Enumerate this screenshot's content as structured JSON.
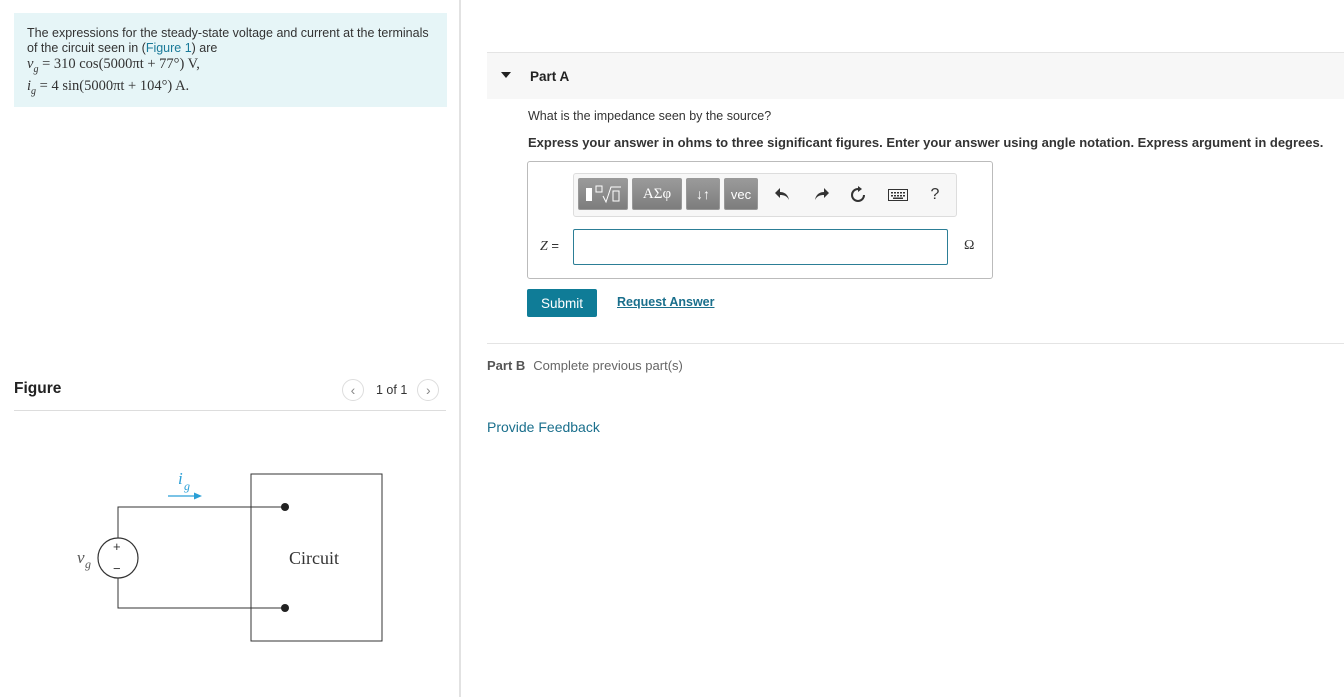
{
  "problem": {
    "text_before_link": "The expressions for the steady-state voltage and current at the terminals of the circuit seen in (",
    "link_text": "Figure 1",
    "text_after_link": ") are",
    "eq1_var": "v",
    "eq1_sub": "g",
    "eq1_rhs": " = 310 cos(5000πt + 77°) V,",
    "eq2_var": "i",
    "eq2_sub": "g",
    "eq2_rhs": " = 4 sin(5000πt + 104°) A."
  },
  "figure": {
    "label": "Figure",
    "pager_text": "1 of 1",
    "prev_icon": "chevron-left-icon",
    "next_icon": "chevron-right-icon",
    "current_label_var": "i",
    "current_label_sub": "g",
    "voltage_label_var": "v",
    "voltage_label_sub": "g",
    "plus": "+",
    "minus": "−",
    "box_label": "Circuit",
    "accent_color": "#2a9fd6"
  },
  "partA": {
    "title": "Part A",
    "question": "What is the impedance seen by the source?",
    "instruction": "Express your answer in ohms to three significant figures. Enter your answer using angle notation. Express argument in degrees.",
    "toolbar": {
      "templates_icon": "templates-icon",
      "greek_label": "ΑΣφ",
      "arrows_label": "↓↑",
      "vec_label": "vec",
      "undo_icon": "undo-icon",
      "redo_icon": "redo-icon",
      "reset_icon": "reset-icon",
      "keyboard_icon": "keyboard-icon",
      "help_label": "?"
    },
    "answer_var": "Z",
    "answer_eq": " =",
    "answer_value": "",
    "unit": "Ω",
    "submit_label": "Submit",
    "request_label": "Request Answer"
  },
  "partB": {
    "title": "Part B",
    "message": "Complete previous part(s)"
  },
  "feedback_label": "Provide Feedback"
}
